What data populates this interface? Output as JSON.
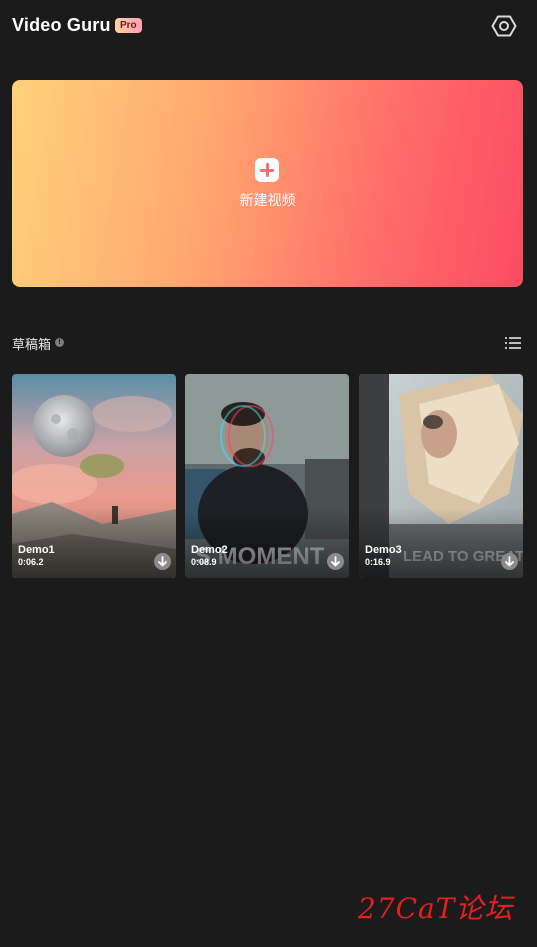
{
  "header": {
    "app_title": "Video Guru",
    "pro_badge": "Pro",
    "settings_icon": "gear-hexagon-icon"
  },
  "new_video": {
    "label": "新建视频",
    "icon": "plus-icon",
    "gradient": [
      "#ffd27c",
      "#ffa46e",
      "#ff6f6a",
      "#fb4b62"
    ]
  },
  "drafts": {
    "title": "草稿箱",
    "info_icon": "info-icon",
    "view_toggle_icon": "list-view-icon",
    "items": [
      {
        "name": "Demo1",
        "duration": "0:06.2",
        "download_icon": "download-icon"
      },
      {
        "name": "Demo2",
        "duration": "0:08.9",
        "download_icon": "download-icon"
      },
      {
        "name": "Demo3",
        "duration": "0:16.9",
        "download_icon": "download-icon"
      }
    ]
  },
  "watermark": "27CaT论坛",
  "colors": {
    "background": "#1b1b1b",
    "accent": "#ff6b73",
    "watermark": "#e32020"
  }
}
